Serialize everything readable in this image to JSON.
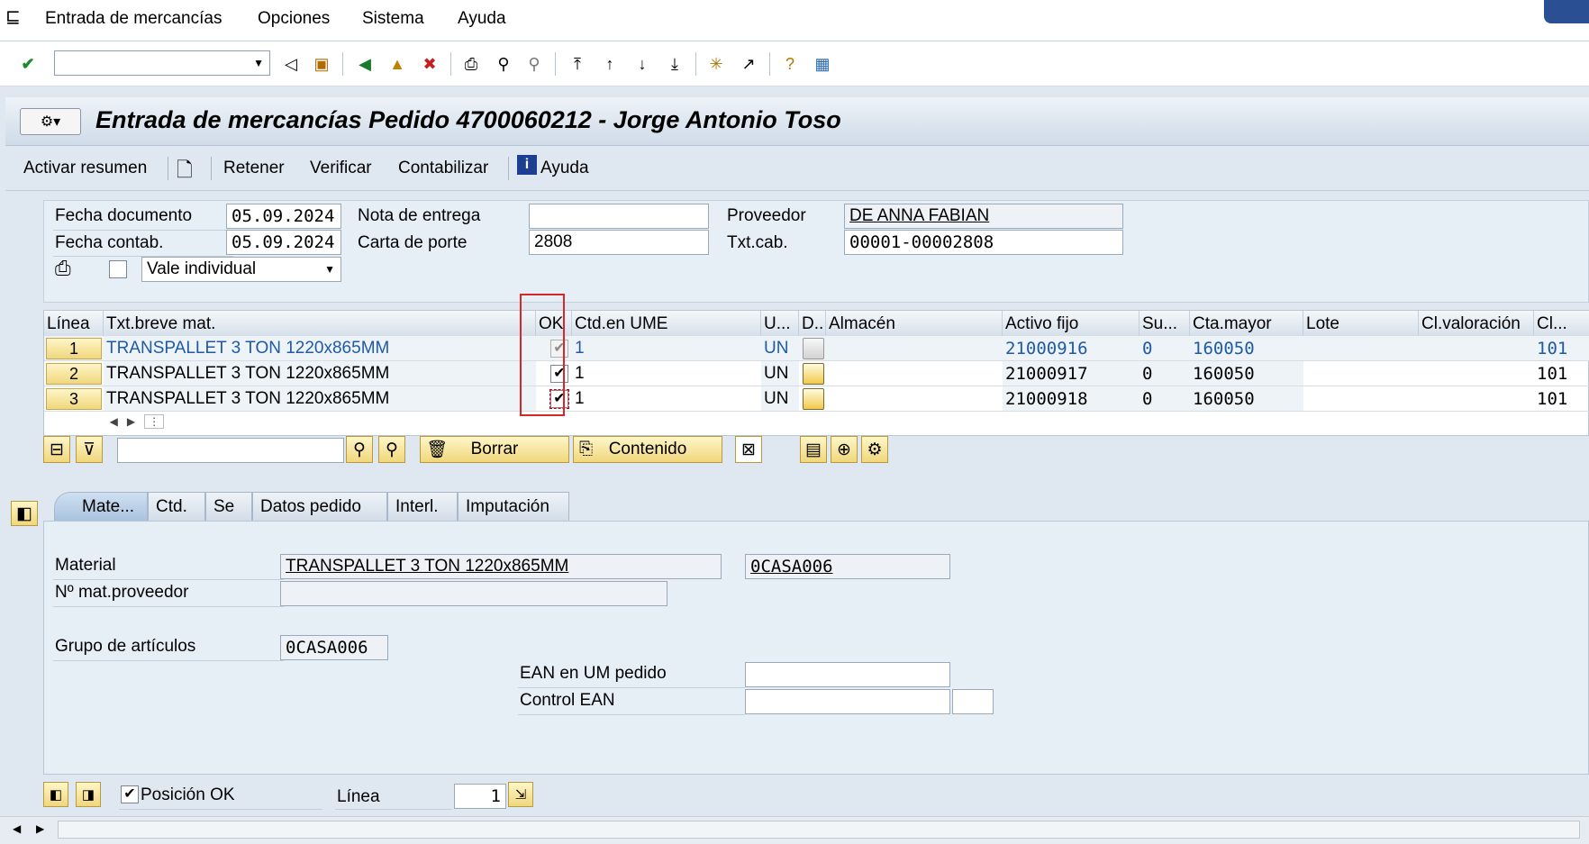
{
  "menu": {
    "app_menu": "Entrada de mercancías",
    "options": "Opciones",
    "system": "Sistema",
    "help": "Ayuda"
  },
  "toolbar": {
    "command_field_value": ""
  },
  "title": "Entrada de mercancías Pedido 4700060212 - Jorge Antonio Toso",
  "app_toolbar": {
    "summary": "Activar resumen",
    "hold": "Retener",
    "check": "Verificar",
    "post": "Contabilizar",
    "help": "Ayuda"
  },
  "header": {
    "doc_date_label": "Fecha documento",
    "doc_date": "05.09.2024",
    "post_date_label": "Fecha contab.",
    "post_date": "05.09.2024",
    "delivery_note_label": "Nota de entrega",
    "delivery_note": "",
    "bill_of_lading_label": "Carta de porte",
    "bill_of_lading": "2808",
    "vendor_label": "Proveedor",
    "vendor": "DE ANNA FABIAN",
    "header_text_label": "Txt.cab.",
    "header_text": "00001-00002808",
    "slip_type": "Vale individual"
  },
  "grid": {
    "columns": [
      "Línea",
      "Txt.breve mat.",
      "OK",
      "Ctd.en UME",
      "U...",
      "D...",
      "Almacén",
      "Activo fijo",
      "Su...",
      "Cta.mayor",
      "Lote",
      "Cl.valoración",
      "Cl..."
    ],
    "rows": [
      {
        "line": "1",
        "text": "TRANSPALLET 3 TON 1220x865MM",
        "ok": true,
        "qty": "1",
        "unit": "UN",
        "store": "",
        "asset": "21000916",
        "sub": "0",
        "gl": "160050",
        "batch": "",
        "val": "",
        "cl": "101"
      },
      {
        "line": "2",
        "text": "TRANSPALLET 3 TON 1220x865MM",
        "ok": true,
        "qty": "1",
        "unit": "UN",
        "store": "",
        "asset": "21000917",
        "sub": "0",
        "gl": "160050",
        "batch": "",
        "val": "",
        "cl": "101"
      },
      {
        "line": "3",
        "text": "TRANSPALLET 3 TON 1220x865MM",
        "ok": true,
        "qty": "1",
        "unit": "UN",
        "store": "",
        "asset": "21000918",
        "sub": "0",
        "gl": "160050",
        "batch": "",
        "val": "",
        "cl": "101"
      }
    ]
  },
  "grid_tools": {
    "delete": "Borrar",
    "contents": "Contenido"
  },
  "tabs": [
    "Mate...",
    "Ctd.",
    "Se",
    "Datos pedido",
    "Interl.",
    "Imputación"
  ],
  "material": {
    "material_label": "Material",
    "material_text": "TRANSPALLET 3 TON 1220x865MM",
    "material_code": "0CASA006",
    "vendor_mat_label": "Nº mat.proveedor",
    "vendor_mat": "",
    "group_label": "Grupo de artículos",
    "group": "0CASA006",
    "ean_label": "EAN en UM pedido",
    "ean": "",
    "ean_ctrl_label": "Control EAN",
    "ean_ctrl": "",
    "ean_ctrl_2": ""
  },
  "footer": {
    "pos_ok_label": "Posición OK",
    "line_label": "Línea",
    "line_value": "1"
  }
}
